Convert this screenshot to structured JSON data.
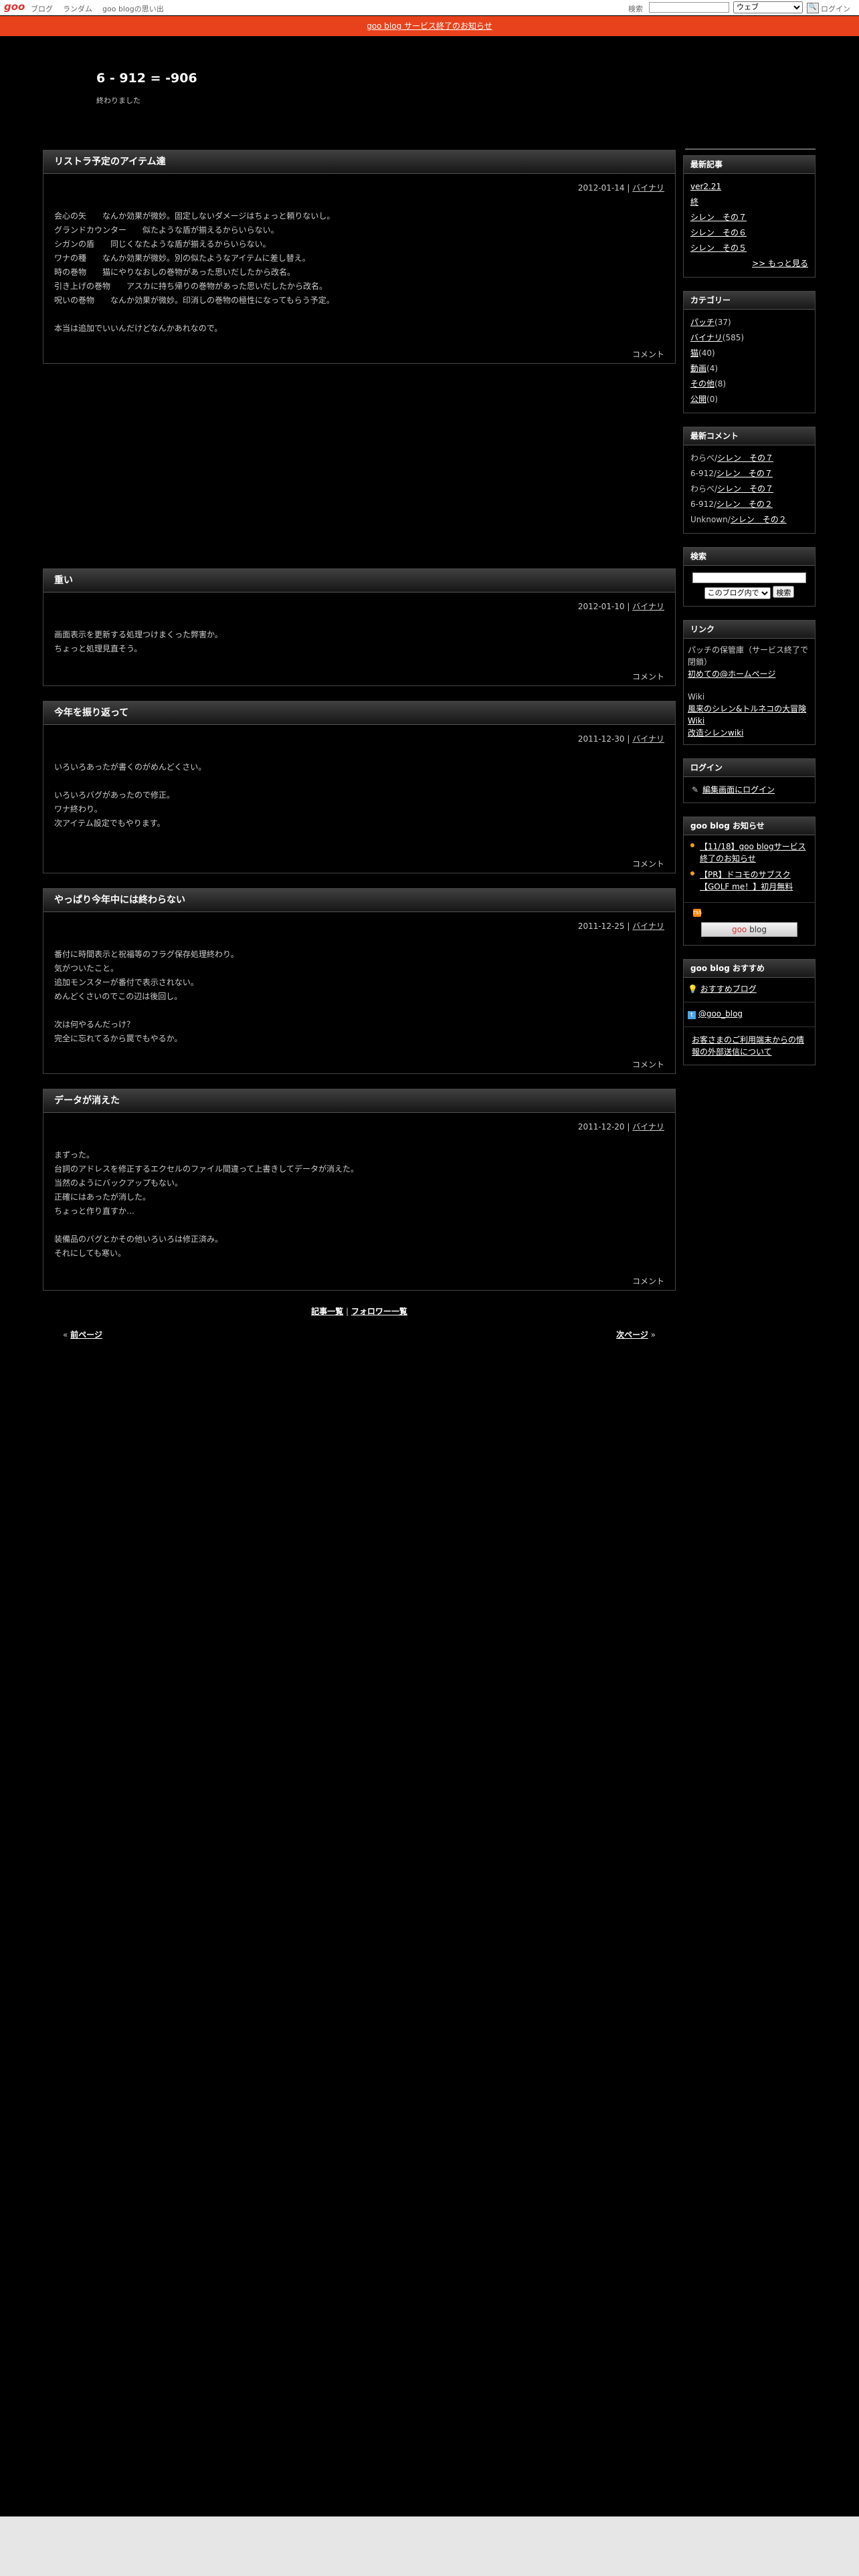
{
  "goobar": {
    "logo": "goo",
    "nav": [
      "ブログ",
      "ランダム",
      "goo blogの思い出"
    ],
    "search_label": "検索",
    "search_select": "ウェブ",
    "search_button": "🔍",
    "login": "ログイン"
  },
  "notice": "goo blog サービス終了のお知らせ",
  "blog": {
    "title": "6 - 912 = -906",
    "description": "終わりました"
  },
  "entries": [
    {
      "title": "リストラ予定のアイテム達",
      "date": "2012-01-14",
      "category": "バイナリ",
      "body": "会心の矢　　なんか効果が微妙。固定しないダメージはちょっと頼りないし。\nグランドカウンター　　似たような盾が揃えるからいらない。\nシガンの盾　　同じくなたような盾が揃えるからいらない。\nワナの種　　なんか効果が微妙。別の似たようなアイテムに差し替え。\n時の巻物　　猫にやりなおしの巻物があった思いだしたから改名。\n引き上げの巻物　　アスカに持ち帰りの巻物があった思いだしたから改名。\n呪いの巻物　　なんか効果が微妙。印消しの巻物の極性になってもらう予定。\n\n本当は追加でいいんだけどなんかあれなので。",
      "comment": "コメント"
    },
    {
      "title": "重い",
      "date": "2012-01-10",
      "category": "バイナリ",
      "body": "画面表示を更新する処理つけまくった弊害か。\nちょっと処理見直そう。",
      "comment": "コメント"
    },
    {
      "title": "今年を振り返って",
      "date": "2011-12-30",
      "category": "バイナリ",
      "body": "いろいろあったが書くのがめんどくさい。\n\nいろいろバグがあったので修正。\nワナ終わり。\n次アイテム設定でもやります。",
      "comment": "コメント"
    },
    {
      "title": "やっぱり今年中には終わらない",
      "date": "2011-12-25",
      "category": "バイナリ",
      "body": "番付に時間表示と祝福等のフラグ保存処理終わり。\n気がついたこと。\n追加モンスターが番付で表示されない。\nめんどくさいのでこの辺は後回し。\n\n次は何やるんだっけ？\n完全に忘れてるから罠でもやるか。",
      "comment": "コメント"
    },
    {
      "title": "データが消えた",
      "date": "2011-12-20",
      "category": "バイナリ",
      "body": "まずった。\n台詞のアドレスを修正するエクセルのファイル間違って上書きしてデータが消えた。\n当然のようにバックアップもない。\n正確にはあったが消した。\nちょっと作り直すか…\n\n装備品のバグとかその他いろいろは修正済み。\nそれにしても寒い。",
      "comment": "コメント"
    }
  ],
  "list_links": {
    "articles": "記事一覧",
    "separator": "|",
    "followers": "フォロワー一覧"
  },
  "pager": {
    "prev_mark": "«",
    "prev": "前ページ",
    "next": "次ページ",
    "next_mark": "»"
  },
  "sidebar": {
    "recent": {
      "heading": "最新記事",
      "items": [
        "ver2.21",
        "終",
        "シレン　その７",
        "シレン　その６",
        "シレン　その５"
      ],
      "more": ">> もっと見る"
    },
    "categories": {
      "heading": "カテゴリー",
      "items": [
        {
          "name": "パッチ",
          "count": "(37)"
        },
        {
          "name": "バイナリ",
          "count": "(585)"
        },
        {
          "name": "猫",
          "count": "(40)"
        },
        {
          "name": "動画",
          "count": "(4)"
        },
        {
          "name": "その他",
          "count": "(8)"
        },
        {
          "name": "公開",
          "count": "(0)"
        }
      ]
    },
    "comments": {
      "heading": "最新コメント",
      "items": [
        {
          "who": "わらべ/",
          "link": "シレン　その７"
        },
        {
          "who": "6-912/",
          "link": "シレン　その７"
        },
        {
          "who": "わらべ/",
          "link": "シレン　その７"
        },
        {
          "who": "6-912/",
          "link": "シレン　その２"
        },
        {
          "who": "Unknown/",
          "link": "シレン　その２"
        }
      ]
    },
    "search": {
      "heading": "検索",
      "select": "このブログ内で",
      "button": "検索"
    },
    "links": {
      "heading": "リンク",
      "group1_text": "パッチの保管庫（サービス終了で閉鎖）",
      "group1_link": "初めての@ホームページ",
      "group2_text": "Wiki",
      "group2_links": [
        "風来のシレン&トルネコの大冒険 Wiki",
        "改造シレンwiki"
      ]
    },
    "login": {
      "heading": "ログイン",
      "link": "編集画面にログイン"
    },
    "goo_news": {
      "heading": "goo blog お知らせ",
      "items": [
        "【11/18】goo blogサービス終了のお知らせ",
        "【PR】ドコモのサブスク【GOLF me！】初月無料"
      ],
      "rss": "rss",
      "badge_g": "goo",
      "badge": " blog"
    },
    "goo_recommend": {
      "heading": "goo blog おすすめ",
      "link": "おすすめブログ",
      "twitter": "@goo_blog",
      "bottom": "お客さまのご利用端末からの情報の外部送信について"
    }
  }
}
